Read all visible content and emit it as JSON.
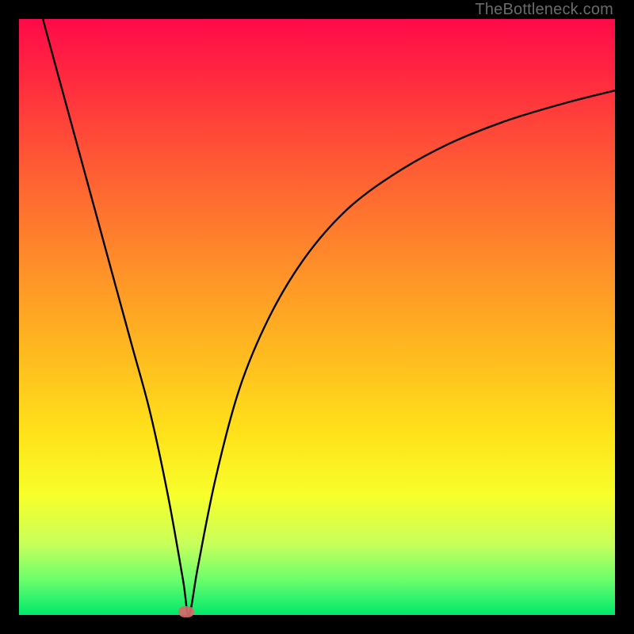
{
  "watermark": "TheBottleneck.com",
  "chart_data": {
    "type": "line",
    "title": "",
    "xlabel": "",
    "ylabel": "",
    "xlim": [
      0,
      100
    ],
    "ylim": [
      0,
      100
    ],
    "grid": false,
    "legend": false,
    "series": [
      {
        "name": "bottleneck-curve",
        "x": [
          4,
          7,
          10,
          13,
          16,
          19,
          22,
          25,
          27.5,
          28.5,
          30,
          33,
          37,
          42,
          48,
          55,
          63,
          72,
          82,
          92,
          100
        ],
        "y": [
          100,
          89,
          78,
          67,
          56,
          45,
          34,
          20,
          6,
          0,
          8,
          23,
          38,
          50,
          60,
          68,
          74,
          79,
          83,
          86,
          88
        ]
      }
    ],
    "marker": {
      "x": 28,
      "y": 0.5,
      "color": "#d66a6a"
    },
    "background_gradient": {
      "top": "#ff0a4a",
      "bottom": "#00e86b",
      "stops": [
        "#ff0a4a",
        "#ff5c34",
        "#ffb720",
        "#ffe31a",
        "#c8ff5a",
        "#00e86b"
      ]
    }
  }
}
